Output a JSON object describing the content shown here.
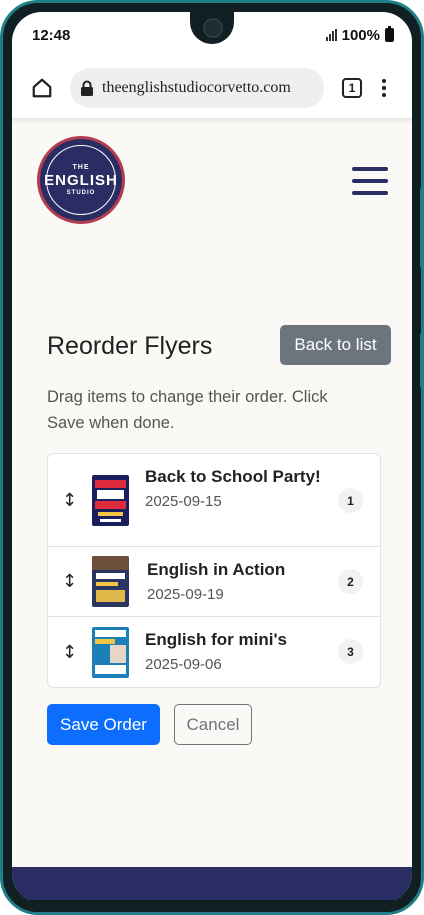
{
  "status_bar": {
    "time": "12:48",
    "battery": "100%"
  },
  "browser": {
    "url": "theenglishstudiocorvetto.com",
    "tab_count": "1"
  },
  "logo": {
    "line1": "THE",
    "line2": "ENGLISH",
    "line3": "STUDIO"
  },
  "page": {
    "title": "Reorder Flyers",
    "back_label": "Back to list",
    "instructions": "Drag items to change their order. Click Save when done."
  },
  "flyers": [
    {
      "title": "Back to School Party!",
      "date": "2025-09-15",
      "order": "1",
      "handle": "↕"
    },
    {
      "title": "English in Action",
      "date": "2025-09-19",
      "order": "2",
      "handle": "↕"
    },
    {
      "title": "English for mini's",
      "date": "2025-09-06",
      "order": "3",
      "handle": "↕"
    }
  ],
  "actions": {
    "save_label": "Save Order",
    "cancel_label": "Cancel"
  },
  "colors": {
    "brand_navy": "#2a2d64",
    "primary": "#0d6efd",
    "secondary": "#6c757d",
    "page_bg": "#fbf9f5"
  }
}
